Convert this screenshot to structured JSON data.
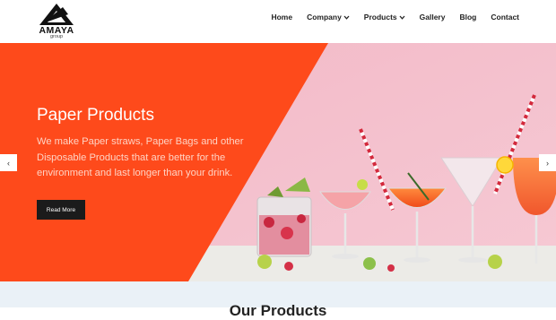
{
  "brand": {
    "name": "AMAYA",
    "tagline": "group"
  },
  "nav": {
    "items": [
      {
        "label": "Home",
        "dropdown": false
      },
      {
        "label": "Company",
        "dropdown": true
      },
      {
        "label": "Products",
        "dropdown": true
      },
      {
        "label": "Gallery",
        "dropdown": false
      },
      {
        "label": "Blog",
        "dropdown": false
      },
      {
        "label": "Contact",
        "dropdown": false
      }
    ]
  },
  "hero": {
    "title": "Paper Products",
    "description": "We make Paper straws, Paper Bags and other Disposable Products that are better for the environment and last longer than your drink.",
    "button_label": "Read More",
    "prev_arrow": "‹",
    "next_arrow": "›",
    "accent_color": "#fe4a1b",
    "image": "cocktail glasses with paper straws on pink background"
  },
  "section": {
    "title": "Our Products"
  }
}
